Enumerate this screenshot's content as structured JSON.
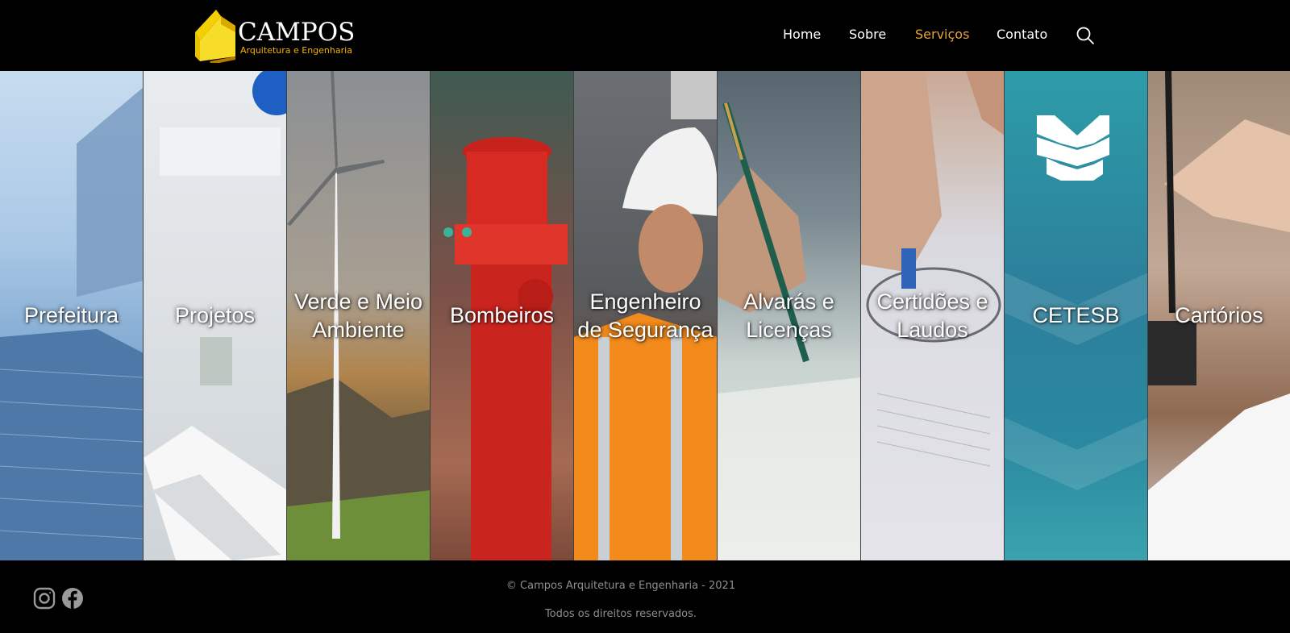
{
  "header": {
    "logo": {
      "name": "CAMPOS",
      "subtitle": "Arquitetura e Engenharia"
    },
    "nav": [
      {
        "label": "Home",
        "active": false
      },
      {
        "label": "Sobre",
        "active": false
      },
      {
        "label": "Serviços",
        "active": true
      },
      {
        "label": "Contato",
        "active": false
      }
    ],
    "search_icon": "search-icon"
  },
  "services": [
    {
      "label": "Prefeitura"
    },
    {
      "label": "Projetos"
    },
    {
      "label": "Verde e Meio Ambiente"
    },
    {
      "label": "Bombeiros"
    },
    {
      "label": "Engenheiro de Segurança"
    },
    {
      "label": "Alvarás e Licenças"
    },
    {
      "label": "Certidões e Laudos"
    },
    {
      "label": "CETESB"
    },
    {
      "label": "Cartórios"
    }
  ],
  "footer": {
    "social_icons": [
      "instagram-icon",
      "facebook-icon"
    ],
    "copyright": "© Campos Arquitetura e Engenharia - 2021",
    "rights": "Todos os direitos reservados."
  },
  "colors": {
    "background": "#000000",
    "nav_active": "#e8a33a",
    "logo_yellow": "#f2b300",
    "footer_text": "#8f8f8f"
  }
}
